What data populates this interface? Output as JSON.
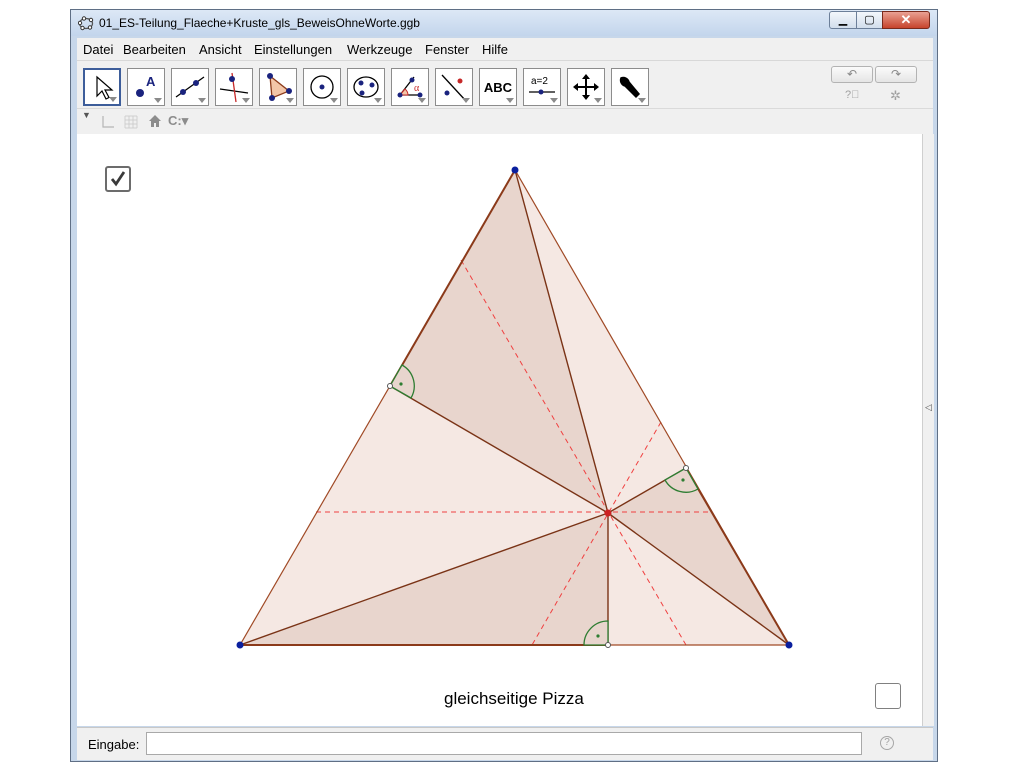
{
  "window": {
    "title": "01_ES-Teilung_Flaeche+Kruste_gls_BeweisOhneWorte.ggb",
    "minimize_icon": "minimize-icon",
    "maximize_icon": "maximize-icon",
    "close_icon": "close-icon"
  },
  "menu": [
    "Datei",
    "Bearbeiten",
    "Ansicht",
    "Einstellungen",
    "Werkzeuge",
    "Fenster",
    "Hilfe"
  ],
  "toolbar": {
    "tools": [
      {
        "name": "move-tool-icon",
        "selected": true
      },
      {
        "name": "point-tool-icon",
        "label": "A"
      },
      {
        "name": "line-tool-icon"
      },
      {
        "name": "perpendicular-line-tool-icon"
      },
      {
        "name": "polygon-tool-icon"
      },
      {
        "name": "circle-center-point-tool-icon"
      },
      {
        "name": "circle-three-points-tool-icon"
      },
      {
        "name": "angle-tool-icon",
        "label": "α"
      },
      {
        "name": "reflect-tool-icon"
      },
      {
        "name": "text-tool-icon",
        "label": "ABC"
      },
      {
        "name": "slider-tool-icon",
        "label": "a=2"
      },
      {
        "name": "move-graphics-view-tool-icon"
      },
      {
        "name": "settings-wrench-tool-icon"
      }
    ],
    "undo_icon": "undo-icon",
    "redo_icon": "redo-icon",
    "help_icon": "help-icon",
    "settings_icon": "gear-icon"
  },
  "stylebar": {
    "toggle_icon": "stylebar-toggle-icon",
    "axes_icon": "axes-icon",
    "grid_icon": "grid-icon",
    "home_icon": "home-icon",
    "point_capture_icon": "point-capture-icon"
  },
  "graphics": {
    "checkbox_top_checked": true,
    "checkbox_bottom_checked": false,
    "caption": "gleichseitige Pizza",
    "colors": {
      "fill_light": "#f5e7e2",
      "fill_dark": "#e7d3cb",
      "edge": "#8b3a1a",
      "dashed": "#ee3333",
      "vertex": "#0a1f9e",
      "right_angle": "#2e7d32",
      "center": "#cc2222"
    }
  },
  "input": {
    "label": "Eingabe:",
    "value": "",
    "help_icon": "help-icon"
  }
}
